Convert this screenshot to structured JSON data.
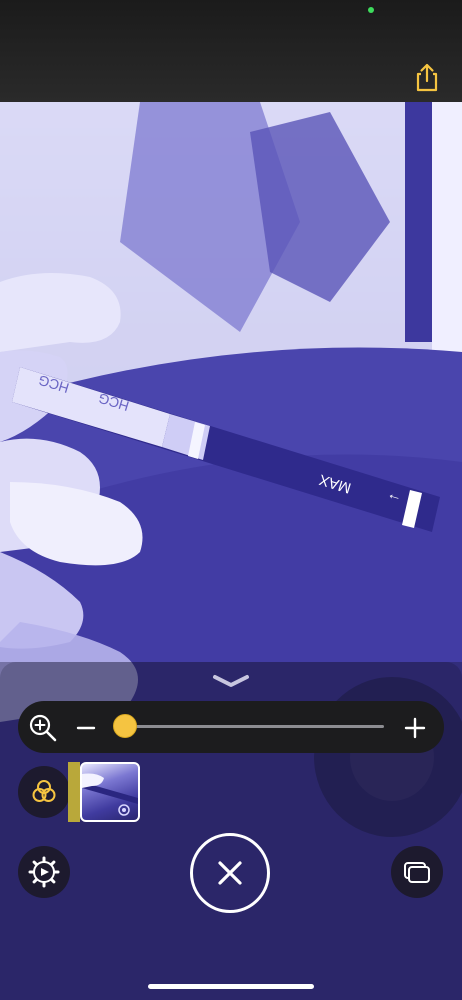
{
  "status": {
    "camera_indicator_color": "#3ddc5c"
  },
  "toolbar": {
    "share_icon": "share-icon",
    "accent_color": "#f5c441"
  },
  "scene": {
    "strip_label_repeated": "HCG",
    "strip_max_label": "MAX",
    "strip_arrow": "→"
  },
  "panel": {
    "collapse_icon": "chevron-down-icon",
    "zoom": {
      "icon": "magnifier-plus-icon",
      "minus_label": "−",
      "plus_label": "+",
      "level": 0.04
    },
    "filters_icon": "filters-icon",
    "settings_icon": "gear-icon",
    "close_icon": "close-icon",
    "multi_capture_icon": "multiple-images-icon"
  }
}
